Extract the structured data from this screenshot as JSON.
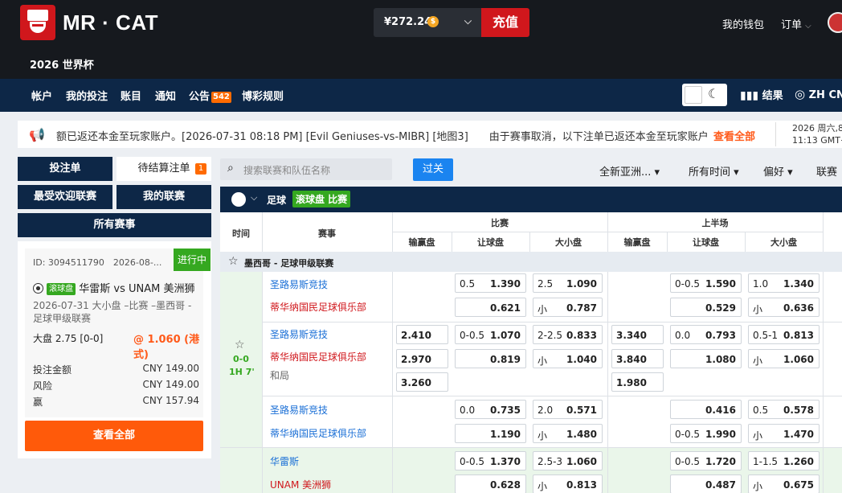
{
  "header": {
    "brand": "MR · CAT",
    "subtitle": "2026 世界杯",
    "balance": "¥272.24",
    "coin": "$",
    "deposit": "充值",
    "wallet": "我的钱包",
    "orders": "订单"
  },
  "nav": {
    "items": [
      "帐户",
      "我的投注",
      "账目",
      "通知",
      "公告",
      "博彩规则"
    ],
    "announce_badge": "542",
    "results": "结果",
    "lang": "ZH CN"
  },
  "announcement": {
    "text": "额已返还本金至玩家账户。[2026-07-31 08:18 PM] [Evil Geniuses-vs-MIBR] [地图3]　　由于赛事取消，以下注单已返还本金至玩家账户",
    "view_all": "查看全部",
    "date": "2026 周六,8月1",
    "time": "11:13 GMT+08:0"
  },
  "left": {
    "betslip": "投注单",
    "pending": "待结算注单",
    "pending_count": "1",
    "popular": "最受欢迎联赛",
    "my_leagues": "我的联赛",
    "all_events": "所有赛事",
    "bet": {
      "id": "ID: 3094511790　2026-08-...",
      "status": "进行中",
      "inplay": "滚球盘",
      "match": "华雷斯 vs UNAM 美洲狮",
      "desc": "2026-07-31 大小盘 –比赛 –墨西哥 - 足球甲级联赛",
      "line": "大盘 2.75 [0-0]",
      "odds": "@ 1.060 (港式)",
      "stake_label": "投注金额",
      "stake": "CNY 149.00",
      "risk_label": "风险",
      "risk": "CNY 149.00",
      "win_label": "赢",
      "win": "CNY 157.94",
      "view_all": "查看全部"
    }
  },
  "filters": {
    "search_placeholder": "搜索联赛和队伍名称",
    "parlay": "过关",
    "region": "全新亚洲...",
    "time": "所有时间",
    "pref": "偏好",
    "league": "联赛"
  },
  "table": {
    "sport": "足球",
    "rollball": "滚球盘 比赛",
    "col_time": "时间",
    "col_event": "赛事",
    "col_match": "比赛",
    "col_half": "上半场",
    "col_1x2": "输赢盘",
    "col_hdp": "让球盘",
    "col_ou": "大小盘",
    "league": "墨西哥 - 足球甲级联赛",
    "score": "0-0",
    "clock": "1H 7'",
    "rows": [
      {
        "home": "圣路易斯竞技",
        "away": "蒂华纳国民足球俱乐部",
        "hdp1_l": "0.5",
        "hdp1_v": "1.390",
        "hdp2_v": "0.621",
        "ou1_l": "2.5",
        "ou1_v": "1.090",
        "ou2_l": "小",
        "ou2_v": "0.787",
        "hhdp1_l": "0-0.5",
        "hhdp1_v": "1.590",
        "hhdp2_v": "0.529",
        "hou1_l": "1.0",
        "hou1_v": "1.340",
        "hou2_l": "小",
        "hou2_v": "0.636"
      },
      {
        "home": "圣路易斯竞技",
        "away": "蒂华纳国民足球俱乐部",
        "draw": "和局",
        "x1": "2.410",
        "x2": "2.970",
        "x3": "3.260",
        "hdp1_l": "0-0.5",
        "hdp1_v": "1.070",
        "hdp2_v": "0.819",
        "ou1_l": "2-2.5",
        "ou1_v": "0.833",
        "ou2_l": "小",
        "ou2_v": "1.040",
        "hx1": "3.340",
        "hx2": "3.840",
        "hx3": "1.980",
        "hhdp1_l": "0.0",
        "hhdp1_v": "0.793",
        "hhdp2_v": "1.080",
        "hou1_l": "0.5-1",
        "hou1_v": "0.813",
        "hou2_l": "小",
        "hou2_v": "1.060"
      },
      {
        "home": "圣路易斯竞技",
        "away": "蒂华纳国民足球俱乐部",
        "hdp1_l": "0.0",
        "hdp1_v": "0.735",
        "hdp2_v": "1.190",
        "ou1_l": "2.0",
        "ou1_v": "0.571",
        "ou2_l": "小",
        "ou2_v": "1.480",
        "hhdp1_v": "0.416",
        "hhdp2_l": "0-0.5",
        "hhdp2_v": "1.990",
        "hou1_l": "0.5",
        "hou1_v": "0.578",
        "hou2_l": "小",
        "hou2_v": "1.470"
      },
      {
        "home": "华雷斯",
        "away": "UNAM 美洲狮",
        "hdp1_l": "0-0.5",
        "hdp1_v": "1.370",
        "hdp2_v": "0.628",
        "ou1_l": "2.5-3",
        "ou1_v": "1.060",
        "ou2_l": "小",
        "ou2_v": "0.813",
        "hhdp1_l": "0-0.5",
        "hhdp1_v": "1.720",
        "hhdp2_v": "0.487",
        "hou1_l": "1-1.5",
        "hou1_v": "1.260",
        "hou2_l": "小",
        "hou2_v": "0.675"
      }
    ]
  }
}
